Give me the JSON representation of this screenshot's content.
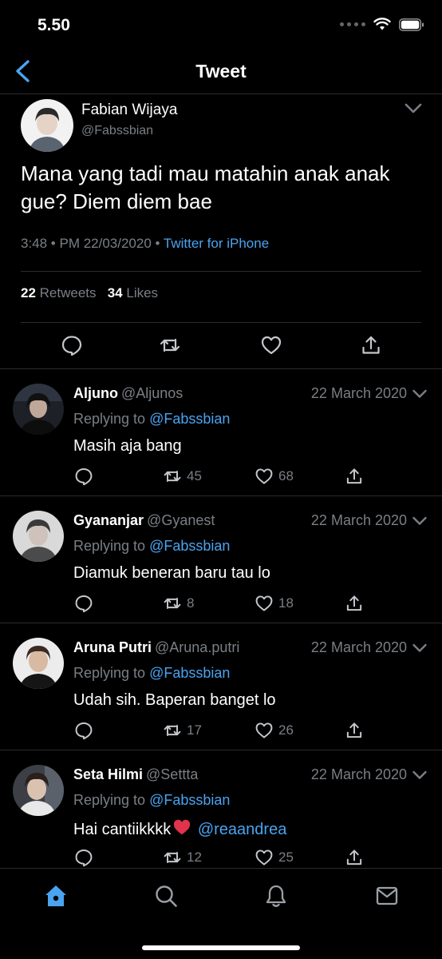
{
  "status_bar": {
    "time": "5.50",
    "icons": [
      "cellular-signal-icon",
      "wifi-icon",
      "battery-icon"
    ]
  },
  "header": {
    "title": "Tweet",
    "back_icon": "chevron-left-icon"
  },
  "main_tweet": {
    "name": "Fabian Wijaya",
    "handle": "@Fabssbian",
    "text": "Mana yang tadi mau matahin anak anak gue? Diem diem bae",
    "time": "3:48 • PM 22/03/2020 • ",
    "source": "Twitter for iPhone",
    "retweets_count": "22",
    "retweets_label": "Retweets",
    "likes_count": "34",
    "likes_label": "Likes",
    "actions": [
      "reply-icon",
      "retweet-icon",
      "like-icon",
      "share-icon"
    ]
  },
  "replies": [
    {
      "name": "Aljuno",
      "handle": "@Aljunos",
      "date": "22 March 2020",
      "replying_label": "Replying to ",
      "replying_to": "@Fabssbian",
      "text": "Masih aja bang",
      "retweets": "45",
      "likes": "68"
    },
    {
      "name": "Gyananjar",
      "handle": "@Gyanest",
      "date": "22 March 2020",
      "replying_label": "Replying to ",
      "replying_to": "@Fabssbian",
      "text": "Diamuk beneran baru tau lo",
      "retweets": "8",
      "likes": "18"
    },
    {
      "name": "Aruna Putri",
      "handle": "@Aruna.putri",
      "date": "22 March 2020",
      "replying_label": "Replying to ",
      "replying_to": "@Fabssbian",
      "text": "Udah sih. Baperan banget lo",
      "retweets": "17",
      "likes": "26"
    },
    {
      "name": "Seta Hilmi",
      "handle": "@Settta",
      "date": "22 March 2020",
      "replying_label": "Replying to ",
      "replying_to": "@Fabssbian",
      "text": "Hai cantiikkkk",
      "text_mention": "@reaandrea",
      "retweets": "12",
      "likes": "25"
    }
  ],
  "tab_bar": {
    "tabs": [
      "home-icon",
      "search-icon",
      "notifications-icon",
      "messages-icon"
    ],
    "active": "home-icon"
  },
  "colors": {
    "background": "#000000",
    "accent": "#4aa3f0",
    "secondary_text": "#7a7f85",
    "divider": "#2b2b2b",
    "heart_emoji": "#e0334c"
  }
}
